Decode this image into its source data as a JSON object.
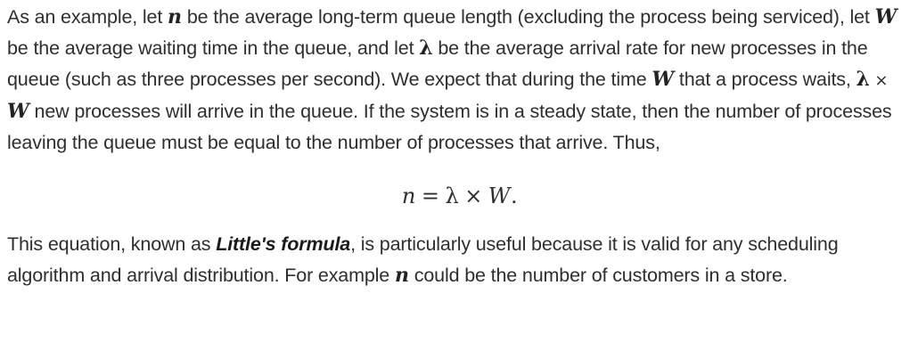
{
  "paragraph1": {
    "t1": "As an example, let ",
    "v1": "n",
    "t2": " be the average long-term queue length (excluding the process being serviced), let ",
    "v2": "W",
    "t3": " be the average waiting time in the queue, and let ",
    "v3": "λ",
    "t4": " be the average arrival rate for new processes in the queue (such as three processes per second). We expect that during the time ",
    "v4": "W",
    "t5": " that a process waits, ",
    "v5": "λ",
    "op1": " × ",
    "v6": "W",
    "t6": " new processes will arrive in the queue. If the system is in a steady state, then the number of processes leaving the queue must be equal to the number of processes that arrive. Thus,"
  },
  "equation": {
    "lhs": "n",
    "eq": "=",
    "lambda": "λ",
    "times": "×",
    "rhs": "W",
    "end": "."
  },
  "paragraph2": {
    "t1": "This equation, known as ",
    "term": "Little's formula",
    "t2": ", is particularly useful because it is valid for any scheduling algorithm and arrival distribution. For example ",
    "v1": "n",
    "t3": " could be the number of customers in a store."
  }
}
